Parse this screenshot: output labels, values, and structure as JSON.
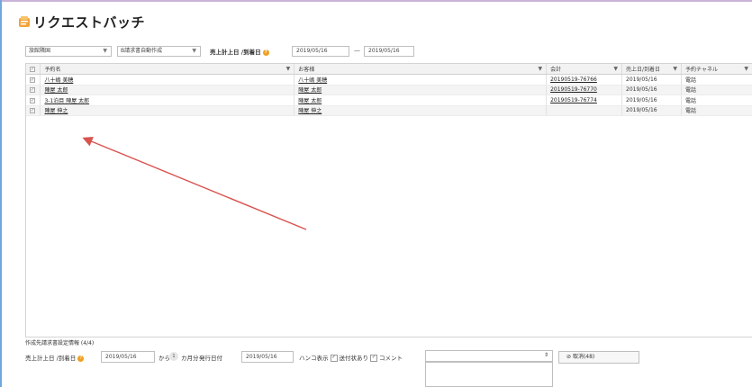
{
  "app": {
    "title": "リクエストバッチ"
  },
  "filters": {
    "select1": "旅館隣国",
    "select2": "B請求書自動作成",
    "date_label": "売上計上日 /到着日",
    "date_from": "2019/05/16",
    "range_sep": "—",
    "date_to": "2019/05/16"
  },
  "grid": {
    "columns": [
      {
        "label": "予約名"
      },
      {
        "label": "お客様"
      },
      {
        "label": "会計"
      },
      {
        "label": "売上日/到着日"
      },
      {
        "label": "予約チャネル"
      }
    ],
    "rows": [
      {
        "checkbox": "✓",
        "name": "八十嶋 美穂",
        "customer": "八十嶋 美穂",
        "invoice": "20190519-76766",
        "date": "2019/05/16",
        "channel": "電話"
      },
      {
        "checkbox": "✓",
        "name": "陣屋 太郎",
        "customer": "陣屋 太郎",
        "invoice": "20190519-76770",
        "date": "2019/05/16",
        "channel": "電話"
      },
      {
        "checkbox": "✓",
        "name": "3-1泊目 陣屋 太郎",
        "customer": "陣屋 太郎",
        "invoice": "20190519-76774",
        "date": "2019/05/16",
        "channel": "電話"
      },
      {
        "checkbox": "✓",
        "name": "陣屋 伸之",
        "customer": "陣屋 伸之",
        "invoice": "",
        "date": "2019/05/16",
        "channel": "電話"
      }
    ]
  },
  "footer": {
    "caption": "作成先請求書設定情報 (4/4)",
    "date_label": "売上計上日 /到着日",
    "date_value": "2019/05/16",
    "from_label": "から",
    "toggle_label": "1",
    "month_label": "カ月分",
    "issue_label": "発行日付",
    "issue_value": "2019/05/16",
    "stamp_label": "ハンコ表示",
    "attach_label": "送付状あり",
    "comment_label": "コメント",
    "combo_value": "",
    "button_label": "取消(48)"
  },
  "colors": {
    "annotation_arrow": "#d9534f",
    "frame_left": "#6fa8dc",
    "frame_top": "#c9b3d6"
  }
}
